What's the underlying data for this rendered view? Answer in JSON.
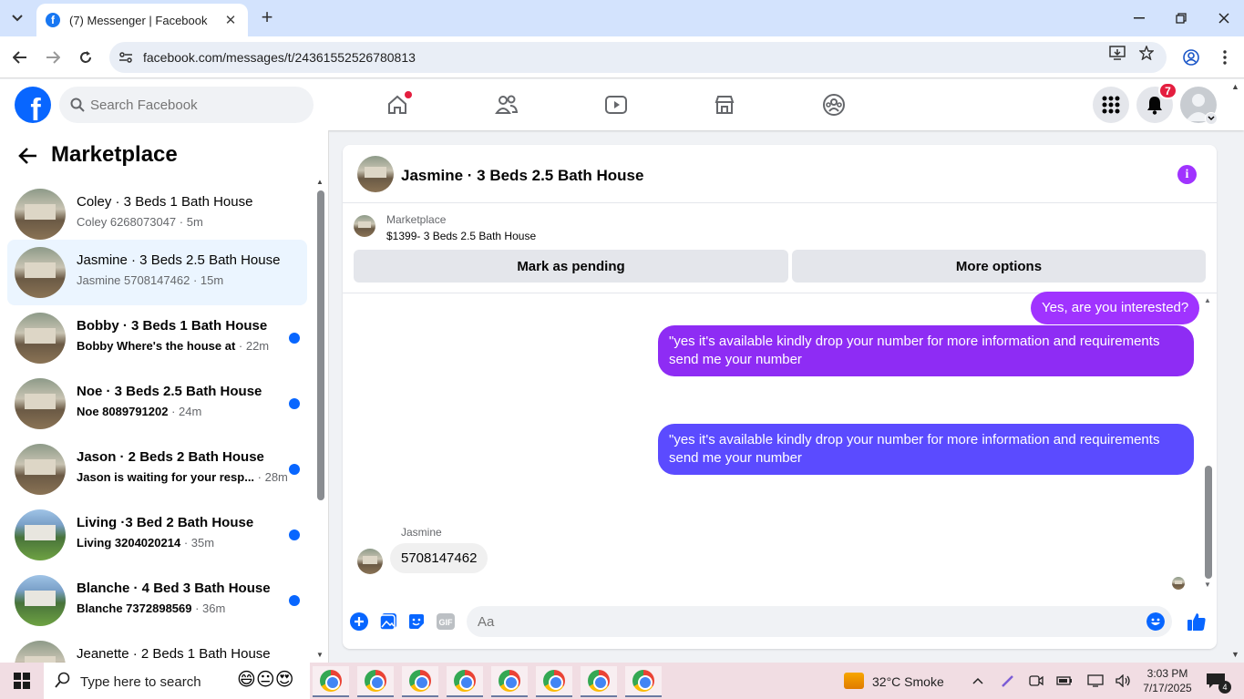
{
  "browser": {
    "tab_title": "(7) Messenger | Facebook",
    "url": "facebook.com/messages/t/24361552526780813",
    "new_tab": "+",
    "close_tab": "✕"
  },
  "fb": {
    "search_placeholder": "Search Facebook",
    "notif_count": "7"
  },
  "sidebar": {
    "title": "Marketplace",
    "conversations": [
      {
        "name": "Coley · 3 Beds 1 Bath House",
        "preview": "Coley 6268073047",
        "time": " · 5m",
        "unread": false
      },
      {
        "name": "Jasmine · 3 Beds 2.5 Bath House",
        "preview": "Jasmine 5708147462",
        "time": " · 15m",
        "unread": false
      },
      {
        "name": "Bobby · 3 Beds 1 Bath House",
        "preview": "Bobby Where's the house at",
        "time": " · 22m",
        "unread": true
      },
      {
        "name": "Noe · 3 Beds 2.5 Bath House",
        "preview": "Noe 8089791202",
        "time": " · 24m",
        "unread": true
      },
      {
        "name": "Jason · 2 Beds 2 Bath House",
        "preview": "Jason is waiting for your resp...",
        "time": " · 28m",
        "unread": true
      },
      {
        "name": "Living ·3 Bed 2 Bath House",
        "preview": "Living 3204020214",
        "time": " · 35m",
        "unread": true
      },
      {
        "name": "Blanche · 4 Bed 3 Bath House",
        "preview": "Blanche 7372898569",
        "time": " · 36m",
        "unread": true
      },
      {
        "name": "Jeanette · 2 Beds 1 Bath House",
        "preview": "",
        "time": "",
        "unread": false
      }
    ]
  },
  "chat": {
    "title": "Jasmine · 3 Beds 2.5 Bath House",
    "listing_source": "Marketplace",
    "listing_title": "$1399- 3 Beds 2.5 Bath House",
    "mark_pending": "Mark as pending",
    "more_options": "More options",
    "messages": {
      "out1": "Yes, are you interested?",
      "out2": "\"yes it's available kindly drop your number for more information and requirements send me your number",
      "out3": "\"yes it's available kindly drop your number for more information and requirements send me your number",
      "in_sender": "Jasmine",
      "in1": "5708147462"
    },
    "composer_placeholder": "Aa"
  },
  "taskbar": {
    "search_text": "Type here to search",
    "weather": "32°C  Smoke",
    "time": "3:03 PM",
    "date": "7/17/2025",
    "notif_count": "4"
  },
  "colors": {
    "fb_blue": "#0866ff",
    "bubble_purple": "#a033ff",
    "bubble_blue": "#5b4bff"
  }
}
